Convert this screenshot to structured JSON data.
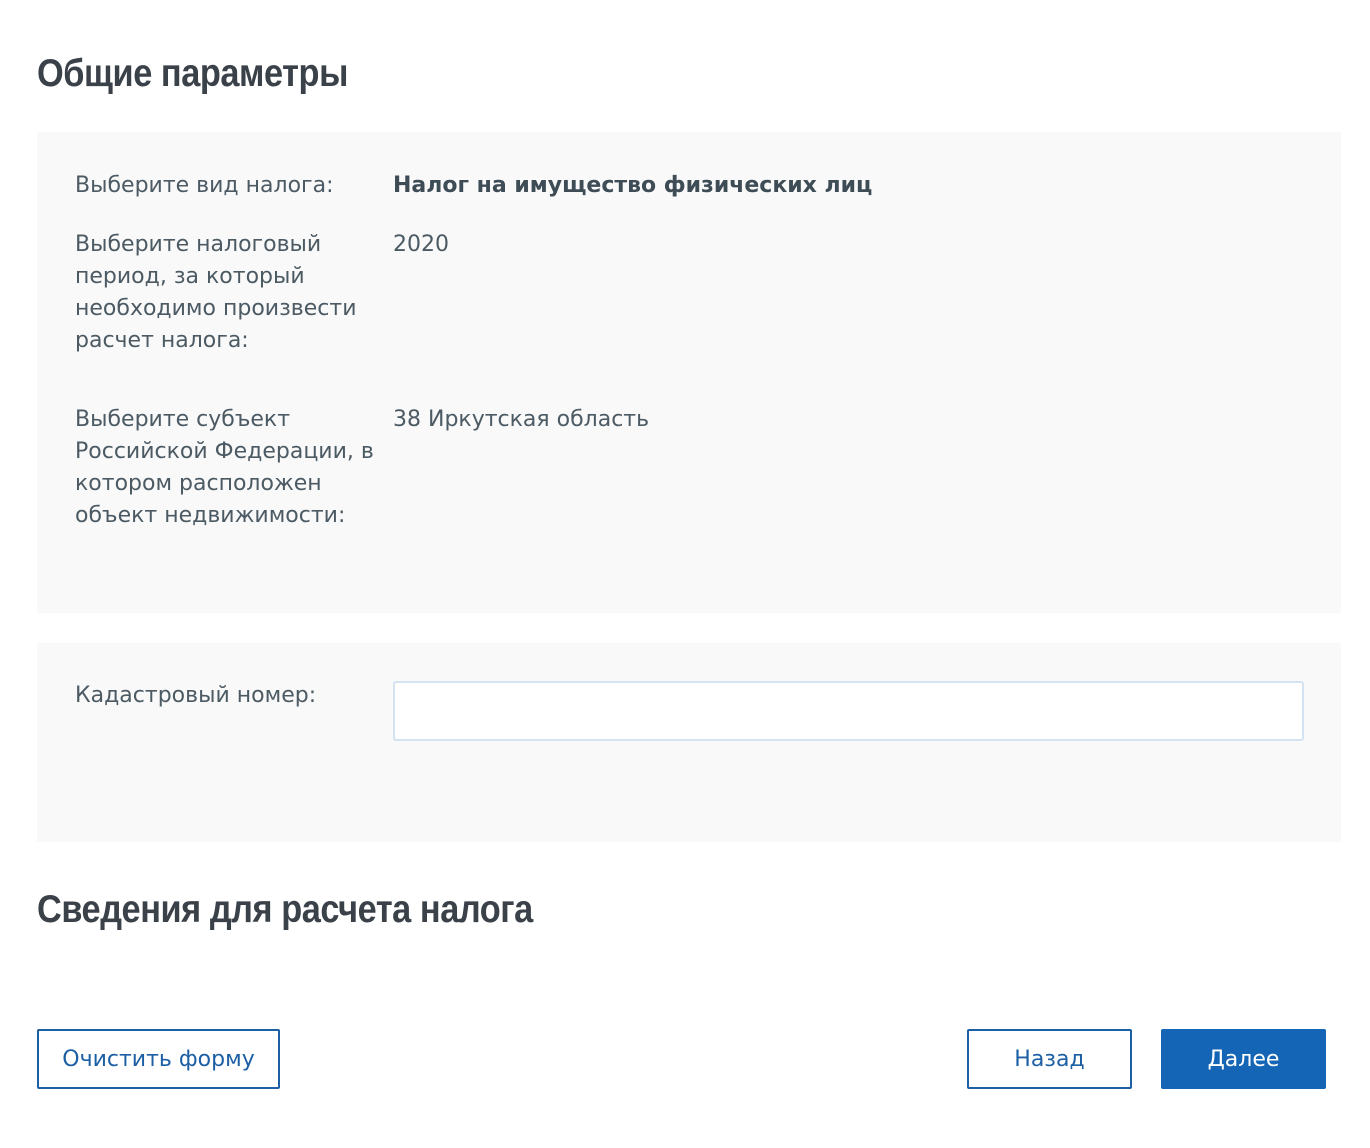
{
  "sections": {
    "general_title": "Общие параметры",
    "calc_title": "Сведения для расчета налога"
  },
  "params": {
    "tax_type": {
      "label": "Выберите вид налога:",
      "value": "Налог на имущество физических лиц"
    },
    "period": {
      "label": "Выберите налоговый период, за который необходимо произвести расчет налога:",
      "value": "2020"
    },
    "region": {
      "label": "Выберите субъект Российской Федерации, в котором расположен объект недвижимости:",
      "value": "38 Иркутская область"
    }
  },
  "cadastral": {
    "label": "Кадастровый номер:",
    "value": "",
    "placeholder": ""
  },
  "buttons": {
    "clear": "Очистить форму",
    "back": "Назад",
    "next": "Далее"
  },
  "colors": {
    "primary": "#1565b6",
    "panel_bg": "#f9f9f9",
    "input_border": "#d4e3f1",
    "title_text": "#3a4148",
    "body_text": "#4c5a64"
  }
}
